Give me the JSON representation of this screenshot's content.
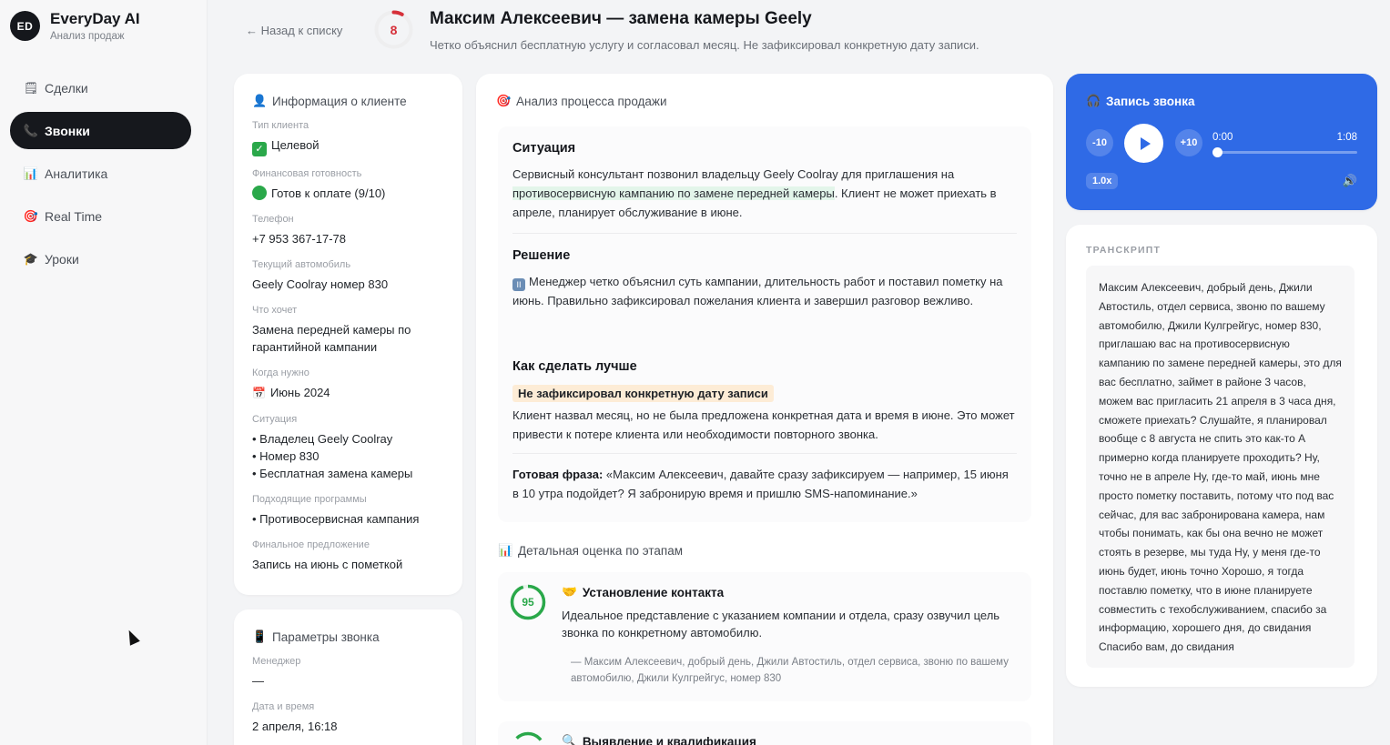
{
  "brand": {
    "logo": "ED",
    "name": "EveryDay AI",
    "subtitle": "Анализ продаж"
  },
  "nav": [
    {
      "label": "Сделки",
      "icon": "notepad-icon",
      "active": false
    },
    {
      "label": "Звонки",
      "icon": "phone-icon",
      "active": true
    },
    {
      "label": "Аналитика",
      "icon": "bar-chart-icon",
      "active": false
    },
    {
      "label": "Real Time",
      "icon": "target-icon",
      "active": false
    },
    {
      "label": "Уроки",
      "icon": "graduation-cap-icon",
      "active": false
    }
  ],
  "header": {
    "back": "← Назад к списку",
    "score": "8",
    "score_value": 8,
    "score_max": 100,
    "title": "Максим Алексеевич — замена камеры Geely",
    "subtitle": "Четко объяснил бесплатную услугу и согласовал месяц. Не зафиксировал конкретную дату записи."
  },
  "client": {
    "title": "Информация о клиенте",
    "fields": {
      "type_label": "Тип клиента",
      "type_value": "Целевой",
      "fin_label": "Финансовая готовность",
      "fin_value": "Готов к оплате (9/10)",
      "phone_label": "Телефон",
      "phone_value": "+7 953 367-17-78",
      "car_label": "Текущий автомобиль",
      "car_value": "Geely Coolray номер 830",
      "want_label": "Что хочет",
      "want_value": "Замена передней камеры по гарантийной кампании",
      "when_label": "Когда нужно",
      "when_value": "Июнь 2024",
      "situation_label": "Ситуация",
      "situation_items": [
        "• Владелец Geely Coolray",
        "• Номер 830",
        "• Бесплатная замена камеры"
      ],
      "programs_label": "Подходящие программы",
      "programs_value": "• Противосервисная кампания",
      "final_label": "Финальное предложение",
      "final_value": "Запись на июнь с пометкой"
    }
  },
  "params": {
    "title": "Параметры звонка",
    "manager_label": "Менеджер",
    "manager_value": "—",
    "date_label": "Дата и время",
    "date_value": "2 апреля, 16:18"
  },
  "analysis": {
    "title": "Анализ процесса продажи",
    "situation_title": "Ситуация",
    "situation_text_pre": "Сервисный консультант позвонил владельцу Geely Coolray для приглашения на ",
    "situation_text_hl": "противосервисную кампанию по замене передней камеры",
    "situation_text_post": ". Клиент не может приехать в апреле, планирует обслуживание в июне.",
    "solution_title": "Решение",
    "solution_text": "Менеджер четко объяснил суть кампании, длительность работ и поставил пометку на июнь. Правильно зафиксировал пожелания клиента и завершил разговор вежливо.",
    "better_title": "Как сделать лучше",
    "better_warning": "Не зафиксировал конкретную дату записи",
    "better_text": "Клиент назвал месяц, но не была предложена конкретная дата и время в июне. Это может привести к потере клиента или необходимости повторного звонка.",
    "ready_label": "Готовая фраза:",
    "ready_text": " «Максим Алексеевич, давайте сразу зафиксируем — например, 15 июня в 10 утра подойдет? Я забронирую время и пришлю SMS-напоминание.»"
  },
  "stages": {
    "title": "Детальная оценка по этапам",
    "items": [
      {
        "score": "95",
        "score_value": 95,
        "name": "Установление контакта",
        "desc": "Идеальное представление с указанием компании и отдела, сразу озвучил цель звонка по конкретному автомобилю.",
        "quote": "— Максим Алексеевич, добрый день, Джили Автостиль, отдел сервиса, звоню по вашему автомобилю, Джили Кулгрейгус, номер 830"
      },
      {
        "name": "Выявление и квалификация"
      }
    ]
  },
  "player": {
    "title": "Запись звонка",
    "back10": "-10",
    "fwd10": "+10",
    "time_current": "0:00",
    "time_total": "1:08",
    "progress": 0,
    "speed": "1.0x"
  },
  "transcript": {
    "title": "ТРАНСКРИПТ",
    "text": "Максим Алексеевич, добрый день, Джили Автостиль, отдел сервиса, звоню по вашему автомобилю, Джили Кулгрейгус, номер 830, приглашаю вас на противосервисную кампанию по замене передней камеры, это для вас бесплатно, займет в районе 3 часов, можем вас пригласить 21 апреля в 3 часа дня, сможете приехать? Слушайте, я планировал вообще с 8 августа не спить это как-то А примерно когда планируете проходить? Ну, точно не в апреле Ну, где-то май, июнь мне просто пометку поставить, потому что под вас сейчас, для вас забронирована камера, нам чтобы понимать, как бы она вечно не может стоять в резерве, мы туда Ну, у меня где-то июнь будет, июнь точно Хорошо, я тогда поставлю пометку, что в июне планируете совместить с техобслуживанием, спасибо за информацию, хорошего дня, до свидания Спасибо вам, до свидания"
  },
  "colors": {
    "accent": "#2f6ae6",
    "danger": "#d6303a",
    "success": "#2aa84a",
    "nav_active": "#16181d"
  }
}
